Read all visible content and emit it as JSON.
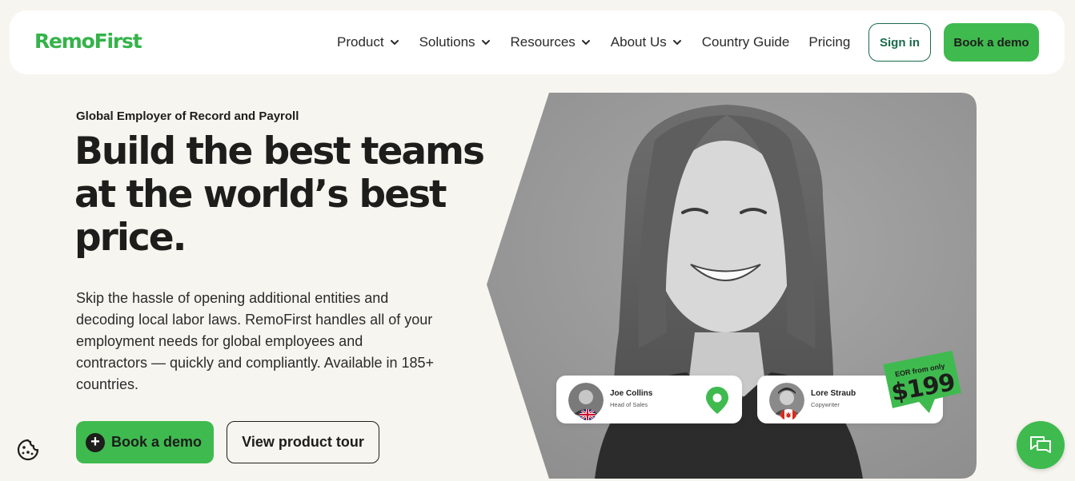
{
  "brand": {
    "logo_text": "RemoFirst",
    "accent": "#3fba4f",
    "dark_green": "#1a6b4a"
  },
  "nav": {
    "items": [
      {
        "label": "Product",
        "has_dropdown": true
      },
      {
        "label": "Solutions",
        "has_dropdown": true
      },
      {
        "label": "Resources",
        "has_dropdown": true
      },
      {
        "label": "About Us",
        "has_dropdown": true
      },
      {
        "label": "Country Guide",
        "has_dropdown": false
      },
      {
        "label": "Pricing",
        "has_dropdown": false
      }
    ],
    "signin_label": "Sign in",
    "demo_label": "Book a demo"
  },
  "hero": {
    "eyebrow": "Global Employer of Record and Payroll",
    "headline_lines": [
      "Build the best teams",
      "at the world’s best",
      "price."
    ],
    "subcopy_lines": [
      "Skip the hassle of opening additional entities and",
      "decoding local labor laws. RemoFirst handles all of your",
      "employment needs for global employees and",
      "contractors — quickly and compliantly. Available in 185+",
      "countries."
    ],
    "cta_primary": "Book a demo",
    "cta_secondary": "View product tour"
  },
  "cards": {
    "joe": {
      "name": "Joe Collins",
      "role": "Head of Sales",
      "flag": "uk-flag-icon"
    },
    "lore": {
      "name": "Lore Straub",
      "role": "Copywriter",
      "flag": "canada-flag-icon"
    }
  },
  "price_badge": {
    "top_text": "EOR from only",
    "price": "$199"
  },
  "icons": {
    "cookie": "cookie-icon",
    "chat": "chat-icon",
    "pin": "location-pin-icon",
    "plus": "plus-icon",
    "chevron": "chevron-down-icon"
  }
}
